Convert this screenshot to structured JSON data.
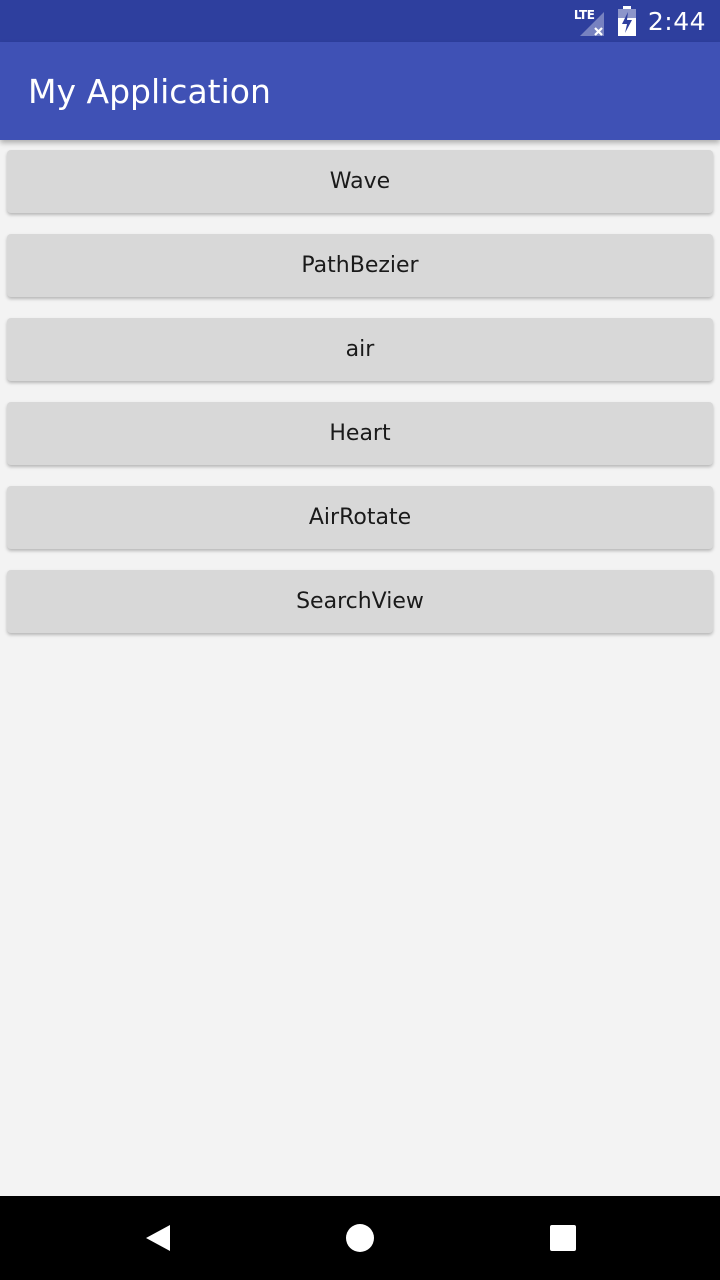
{
  "status_bar": {
    "network_label": "LTE",
    "time": "2:44",
    "icons": [
      "lte-signal-icon",
      "battery-charging-icon"
    ]
  },
  "app_bar": {
    "title": "My Application"
  },
  "buttons": [
    {
      "label": "Wave"
    },
    {
      "label": "PathBezier"
    },
    {
      "label": "air"
    },
    {
      "label": "Heart"
    },
    {
      "label": "AirRotate"
    },
    {
      "label": "SearchView"
    }
  ],
  "nav_bar": {
    "icons": [
      "back-icon",
      "home-icon",
      "recents-icon"
    ]
  },
  "colors": {
    "status_bar": "#2e3f9e",
    "app_bar": "#3f51b5",
    "background": "#f3f3f3",
    "button": "#d8d8d8",
    "nav_bar": "#000000"
  }
}
